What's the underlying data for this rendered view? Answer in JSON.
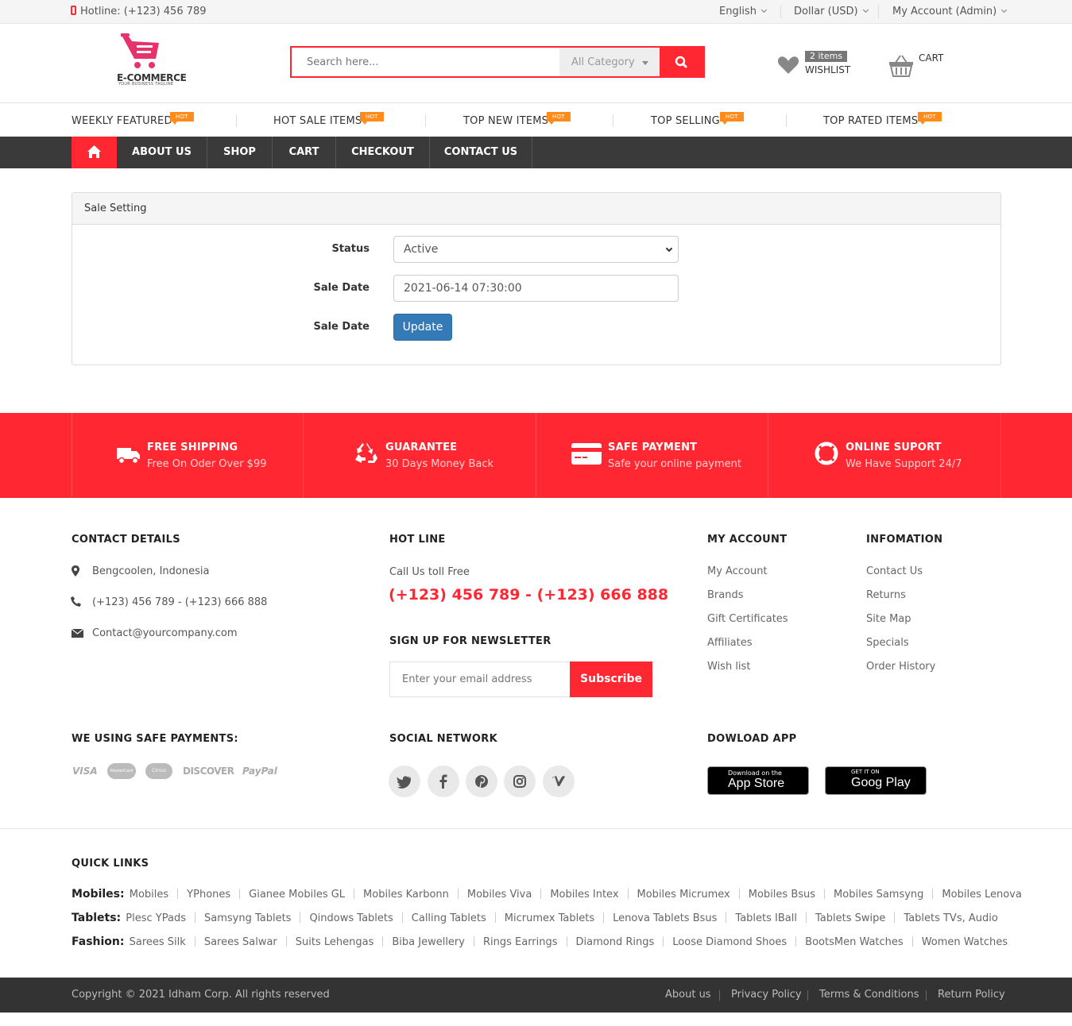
{
  "topbar": {
    "hotline": "Hotline: (+123) 456 789",
    "language": "English",
    "currency": "Dollar (USD)",
    "account": "My Account (Admin)"
  },
  "header": {
    "logo_title": "E-COMMERCE",
    "logo_tagline": "YOUR BUSINESS TAGLINE",
    "search_placeholder": "Search here...",
    "category": "All Category",
    "wishlist_count": "2 items",
    "wishlist_label": "WISHLIST",
    "cart_label": "CART"
  },
  "featured": [
    {
      "label": "WEEKLY FEATURED",
      "badge": "HOT"
    },
    {
      "label": "HOT SALE ITEMS",
      "badge": "HOT"
    },
    {
      "label": "TOP NEW ITEMS",
      "badge": "HOT"
    },
    {
      "label": "TOP SELLING",
      "badge": "HOT"
    },
    {
      "label": "TOP RATED ITEMS",
      "badge": "HOT"
    }
  ],
  "nav": {
    "items": [
      "ABOUT US",
      "SHOP",
      "CART",
      "CHECKOUT",
      "CONTACT US"
    ]
  },
  "panel": {
    "title": "Sale Setting",
    "status_label": "Status",
    "status_value": "Active",
    "date_label": "Sale Date",
    "date_value": "2021-06-14 07:30:00",
    "date_label2": "Sale Date",
    "update": "Update"
  },
  "features": [
    {
      "title": "FREE SHIPPING",
      "sub": "Free On Oder Over $99"
    },
    {
      "title": "GUARANTEE",
      "sub": "30 Days Money Back"
    },
    {
      "title": "SAFE PAYMENT",
      "sub": "Safe your online payment"
    },
    {
      "title": "ONLINE SUPORT",
      "sub": "We Have Support 24/7"
    }
  ],
  "footer": {
    "contact_title": "CONTACT DETAILS",
    "address": "Bengcoolen, Indonesia",
    "phone": "(+123) 456 789 - (+123) 666 888",
    "email": "Contact@yourcompany.com",
    "hotline_title": "HOT LINE",
    "call_text": "Call Us toll Free",
    "hotline_numbers": "(+123) 456 789 - (+123) 666 888",
    "newsletter_title": "SIGN UP FOR NEWSLETTER",
    "newsletter_placeholder": "Enter your email address",
    "subscribe": "Subscribe",
    "account_title": "MY ACCOUNT",
    "account_links": [
      "My Account",
      "Brands",
      "Gift Certificates",
      "Affiliates",
      "Wish list"
    ],
    "info_title": "INFOMATION",
    "info_links": [
      "Contact Us",
      "Returns",
      "Site Map",
      "Specials",
      "Order History"
    ],
    "payments_title": "WE USING SAFE PAYMENTS:",
    "payments": [
      "VISA",
      "MasterCard",
      "Cirrus",
      "DISCOVER",
      "PayPal"
    ],
    "social_title": "SOCIAL NETWORK",
    "app_title": "DOWLOAD APP",
    "appstore_small": "Download on the",
    "appstore_big": "App Store",
    "gplay_small": "GET IT ON",
    "gplay_big": "Goog Play"
  },
  "quick_links": {
    "title": "QUICK LINKS",
    "rows": [
      {
        "label": "Mobiles:",
        "items": [
          "Mobiles",
          "YPhones",
          "Gianee Mobiles GL",
          "Mobiles Karbonn",
          "Mobiles Viva",
          "Mobiles Intex",
          "Mobiles Micrumex",
          "Mobiles Bsus",
          "Mobiles Samsyng",
          "Mobiles Lenova"
        ]
      },
      {
        "label": "Tablets:",
        "items": [
          "Plesc YPads",
          "Samsyng Tablets",
          "Qindows Tablets",
          "Calling Tablets",
          "Micrumex Tablets",
          "Lenova Tablets Bsus",
          "Tablets IBall",
          "Tablets Swipe",
          "Tablets TVs, Audio"
        ]
      },
      {
        "label": "Fashion:",
        "items": [
          "Sarees Silk",
          "Sarees Salwar",
          "Suits Lehengas",
          "Biba Jewellery",
          "Rings Earrings",
          "Diamond Rings",
          "Loose Diamond Shoes",
          "BootsMen Watches",
          "Women Watches"
        ]
      }
    ]
  },
  "copyright": {
    "text": "Copyright © 2021 Idham Corp. All rights reserved",
    "links": [
      "About us",
      "Privacy Policy",
      "Terms & Conditions",
      "Return Policy"
    ]
  },
  "colors": {
    "accent": "#ff2832",
    "nav_bg": "#3a3a3a",
    "hot_badge": "#ff8c1a",
    "button_blue": "#337ab7"
  }
}
